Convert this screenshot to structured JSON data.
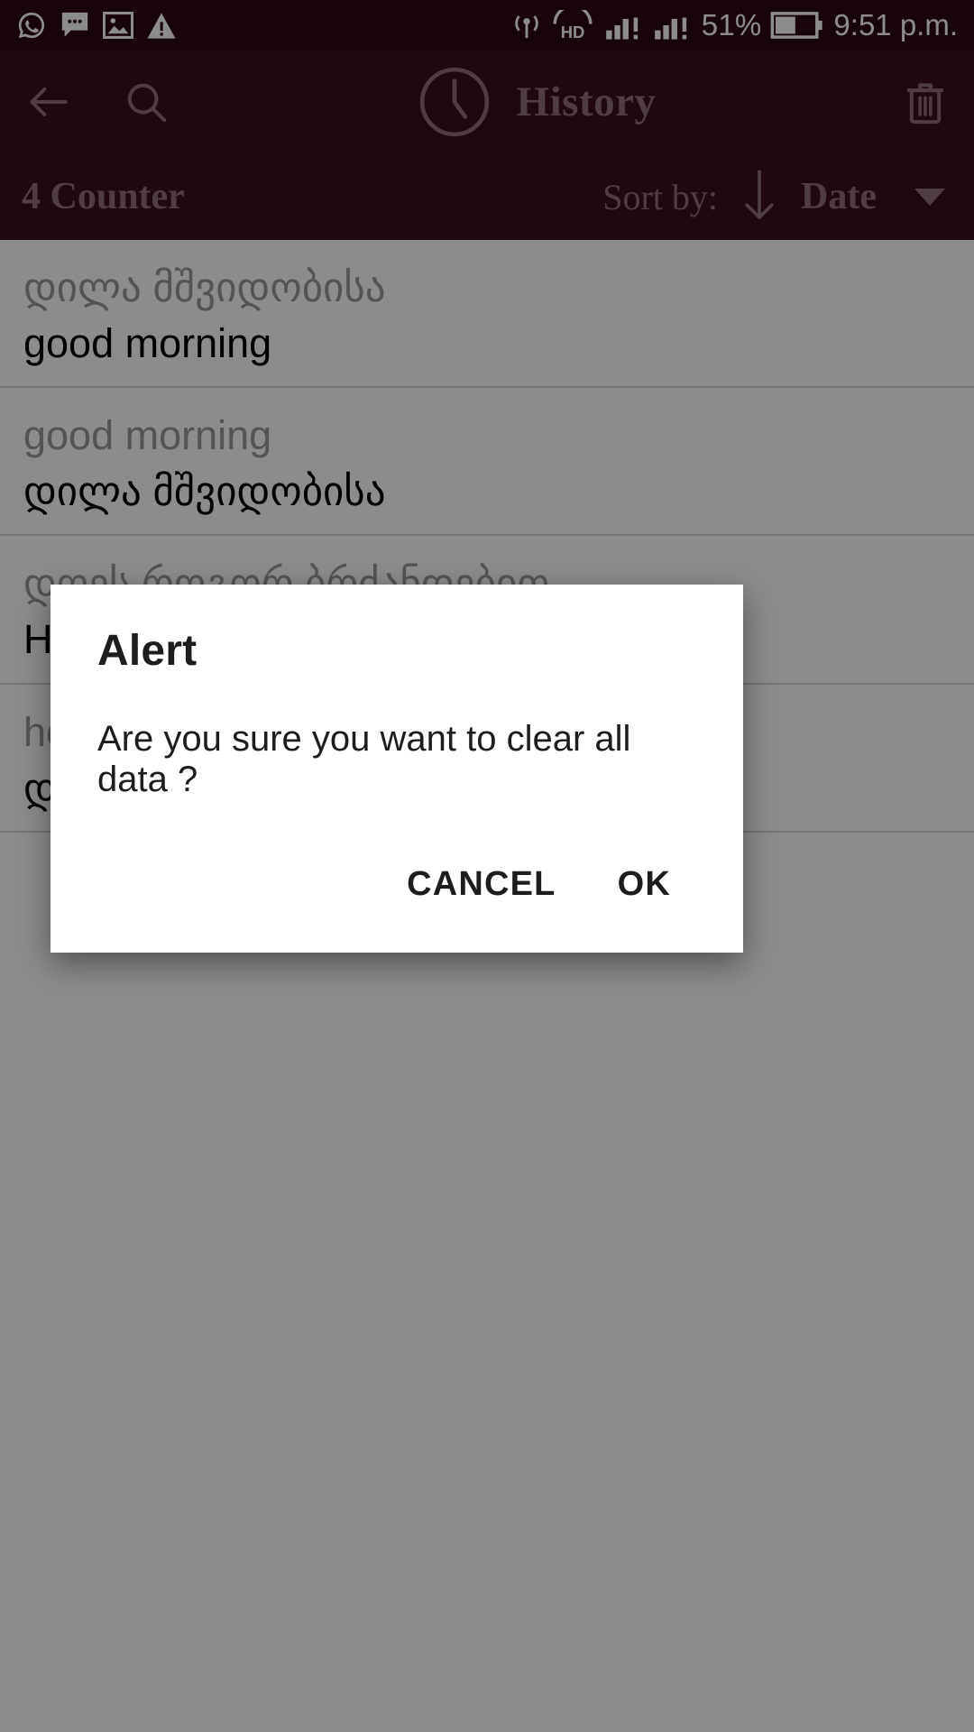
{
  "status_bar": {
    "left_icons": [
      "whatsapp-icon",
      "message-bubble-icon",
      "image-icon",
      "warning-triangle-icon"
    ],
    "right_icons": [
      "hotspot-icon",
      "volte-hd-icon",
      "signal-bars-1-icon",
      "signal-bars-2-icon",
      "battery-icon"
    ],
    "hd_label": "HD",
    "battery_percent": "51%",
    "time": "9:51 p.m.",
    "background": "#2c0a16",
    "foreground": "#ffffff"
  },
  "toolbar": {
    "back_icon": "arrow-left-icon",
    "search_icon": "search-icon",
    "clock_icon": "clock-icon",
    "title": "History",
    "delete_icon": "trash-icon",
    "background": "#3a0f1f",
    "foreground": "#8e7078"
  },
  "sort_bar": {
    "counter": "4 Counter",
    "sort_label": "Sort by:",
    "direction_icon": "arrow-down-icon",
    "sort_value": "Date",
    "dropdown_icon": "chevron-down-icon"
  },
  "history": {
    "items": [
      {
        "source": "დილა მშვიდობისა",
        "target": "good morning"
      },
      {
        "source": "good morning",
        "target": "დილა მშვიდობისა"
      },
      {
        "source": "დღეს როგორ ბრძანდებით",
        "target": "How bizarre today"
      },
      {
        "source": "how are you today",
        "target": "დღეს როგორ ბრძანდებით"
      }
    ]
  },
  "dialog": {
    "title": "Alert",
    "message": "Are you sure you want to clear all data ?",
    "cancel_label": "CANCEL",
    "ok_label": "OK"
  }
}
